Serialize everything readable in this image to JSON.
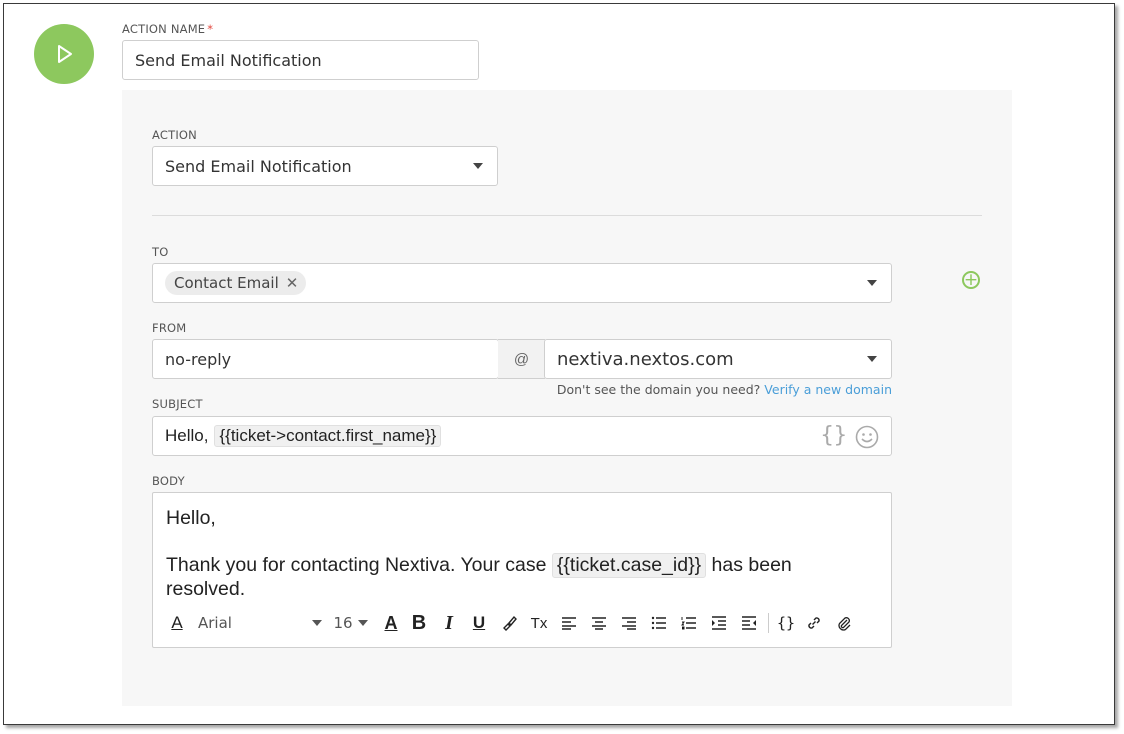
{
  "action_name": {
    "label": "ACTION NAME",
    "required_mark": "*",
    "value": "Send Email Notification"
  },
  "action": {
    "label": "ACTION",
    "selected": "Send Email Notification"
  },
  "to": {
    "label": "TO",
    "chips": [
      "Contact Email"
    ],
    "remove_glyph": "✕"
  },
  "from": {
    "label": "FROM",
    "local_part": "no-reply",
    "at": "@",
    "domain": "nextiva.nextos.com",
    "hint": "Don't see the domain you need?",
    "hint_link": "Verify a new domain"
  },
  "subject": {
    "label": "SUBJECT",
    "prefix": "Hello,",
    "token": "{{ticket->contact.first_name}}",
    "braces_icon": "{}"
  },
  "body": {
    "label": "BODY",
    "line1": "Hello,",
    "line2_pre": "Thank you for contacting Nextiva. Your case",
    "token": "{{ticket.case_id}}",
    "line2_post": "has been resolved."
  },
  "toolbar": {
    "font": "Arial",
    "size": "16",
    "bold": "B",
    "italic": "I",
    "underline": "U",
    "font_color": "A",
    "bg_color": "A",
    "clear_format": "Tx",
    "braces": "{}"
  },
  "colors": {
    "accent_green": "#8dc85e",
    "link_blue": "#4a9ed8",
    "panel_bg": "#f7f7f7"
  }
}
